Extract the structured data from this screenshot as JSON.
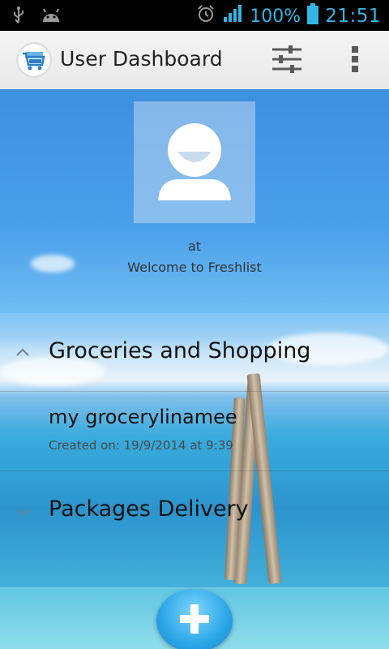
{
  "status_bar": {
    "battery": "100%",
    "time": "21:51"
  },
  "action_bar": {
    "title": "User Dashboard"
  },
  "profile": {
    "name": "at",
    "welcome": "Welcome to Freshlist"
  },
  "groups": [
    {
      "label": "Groceries and Shopping",
      "expanded": true,
      "items": [
        {
          "title": "my grocerylinamee",
          "subtitle": "Created on: 19/9/2014 at 9:39"
        }
      ]
    },
    {
      "label": "Packages Delivery",
      "expanded": false
    }
  ],
  "colors": {
    "accent": "#33b5e5",
    "fab": "#2aa6e6"
  },
  "icons": [
    "usb-icon",
    "android-icon",
    "alarm-icon",
    "signal-icon",
    "battery-icon",
    "app-logo-cart-icon",
    "filter-sliders-icon",
    "overflow-menu-icon",
    "chevron-up-icon",
    "chevron-down-icon",
    "user-avatar-icon",
    "add-icon"
  ]
}
